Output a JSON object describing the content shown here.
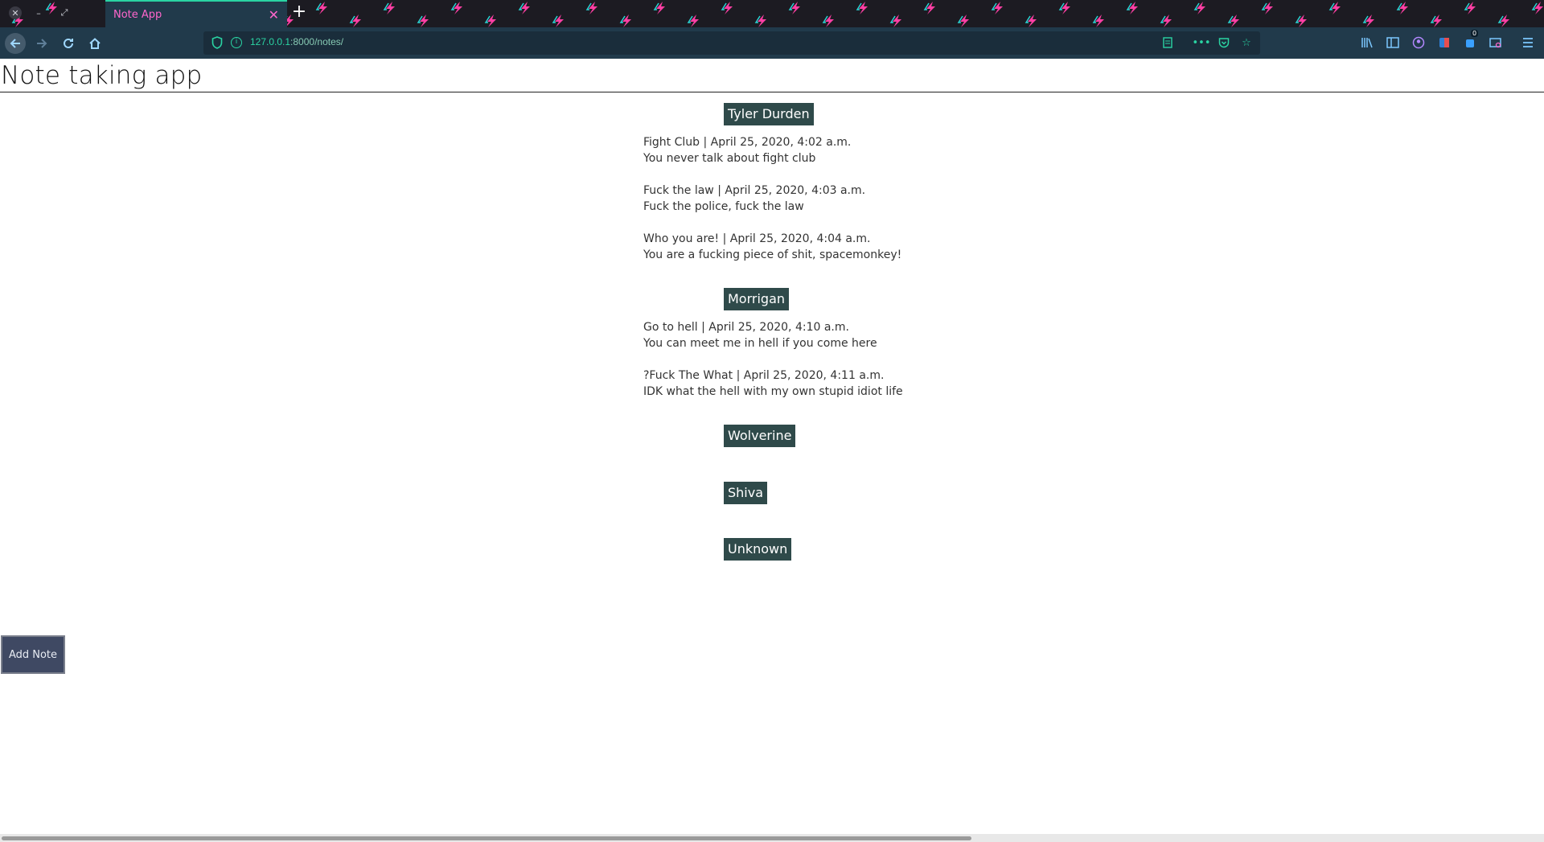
{
  "browser": {
    "tab_title": "Note App",
    "new_tab_symbol": "+",
    "url_host": "127.0.0.1",
    "url_rest": ":8000/notes/",
    "notification_count": "0",
    "accent_color": "#2ad4a3",
    "tab_text_color": "#ff66cc",
    "chrome_color": "#213a4b"
  },
  "page": {
    "title": "Note taking app",
    "add_note_label": "Add Note",
    "author_badge_color": "#2f4a4a"
  },
  "authors": [
    {
      "name": "Tyler Durden",
      "notes": [
        {
          "heading": "Fight Club | April 25, 2020, 4:02 a.m.",
          "body": "You never talk about fight club"
        },
        {
          "heading": "Fuck the law | April 25, 2020, 4:03 a.m.",
          "body": "Fuck the police, fuck the law"
        },
        {
          "heading": "Who you are! | April 25, 2020, 4:04 a.m.",
          "body": "You are a fucking piece of shit, spacemonkey!"
        }
      ]
    },
    {
      "name": "Morrigan",
      "notes": [
        {
          "heading": "Go to hell | April 25, 2020, 4:10 a.m.",
          "body": "You can meet me in hell if you come here"
        },
        {
          "heading": "?Fuck The What | April 25, 2020, 4:11 a.m.",
          "body": "IDK what the hell with my own stupid idiot life"
        }
      ]
    },
    {
      "name": "Wolverine",
      "notes": []
    },
    {
      "name": "Shiva",
      "notes": []
    },
    {
      "name": "Unknown",
      "notes": []
    }
  ]
}
